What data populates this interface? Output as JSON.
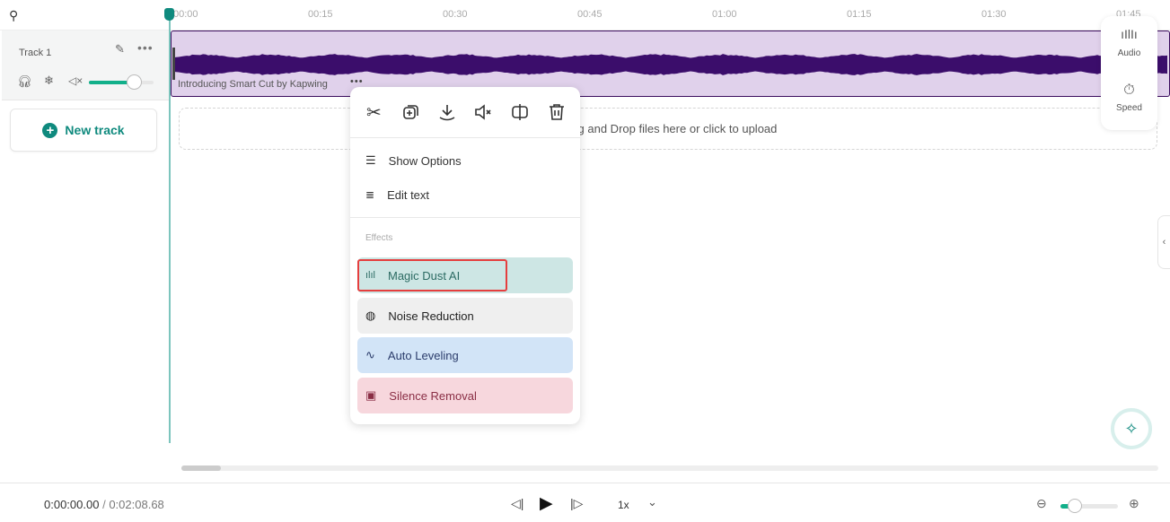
{
  "ruler": {
    "ticks": [
      "00:00",
      "00:15",
      "00:30",
      "00:45",
      "01:00",
      "01:15",
      "01:30",
      "01:45"
    ]
  },
  "track": {
    "name": "Track 1",
    "volume_percent": 70,
    "clip_title": "Introducing Smart Cut by Kapwing"
  },
  "new_track_label": "New track",
  "dropzone_text": "Drag and Drop files here or click to upload",
  "context_menu": {
    "actions": [
      "cut",
      "duplicate",
      "download",
      "mute",
      "split",
      "delete"
    ],
    "items": [
      {
        "label": "Show Options"
      },
      {
        "label": "Edit text"
      }
    ],
    "effects_heading": "Effects",
    "effects": [
      {
        "label": "Magic Dust AI",
        "bg": "#cde6e4",
        "fg": "#2c6b63"
      },
      {
        "label": "Noise Reduction",
        "bg": "#efefef",
        "fg": "#222"
      },
      {
        "label": "Auto Leveling",
        "bg": "#d2e4f7",
        "fg": "#2b3c6b"
      },
      {
        "label": "Silence Removal",
        "bg": "#f7d7dd",
        "fg": "#8a2e45"
      }
    ]
  },
  "side_panel": {
    "audio_label": "Audio",
    "speed_label": "Speed"
  },
  "player": {
    "current_time": "0:00:00.00",
    "separator": "/",
    "duration": "0:02:08.68",
    "speed": "1x",
    "zoom_percent": 25
  },
  "colors": {
    "accent": "#0f8a7e",
    "waveform": "#3b0d6b",
    "highlight": "#e53e3e"
  }
}
